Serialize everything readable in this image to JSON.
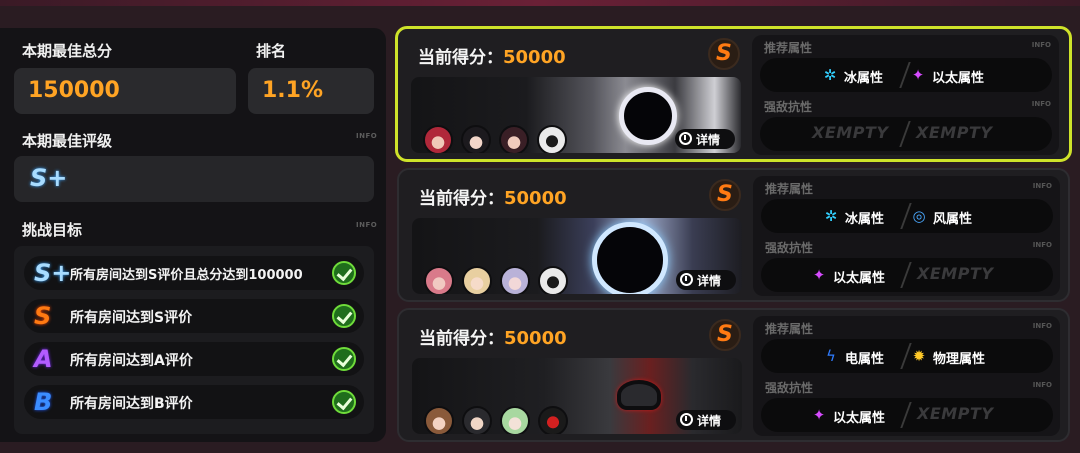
{
  "left": {
    "best_score_label": "本期最佳总分",
    "rank_label": "排名",
    "best_score": "150000",
    "rank": "1.1%",
    "best_grade_label": "本期最佳评级",
    "info": "INFO",
    "best_grade": "S+",
    "goals_label": "挑战目标",
    "goals": [
      {
        "badge": "S+",
        "text": "所有房间达到S评价且总分达到100000"
      },
      {
        "badge": "S",
        "text": "所有房间达到S评价"
      },
      {
        "badge": "A",
        "text": "所有房间达到A评价"
      },
      {
        "badge": "B",
        "text": "所有房间达到B评价"
      }
    ]
  },
  "rooms": [
    {
      "score_label": "当前得分：",
      "score": "50000",
      "grade": "S",
      "detail": "详情",
      "recommend_label": "推荐属性",
      "resist_label": "强敌抗性",
      "info": "INFO",
      "recommend": [
        "冰属性",
        "以太属性"
      ],
      "resist": [
        "EMPTY",
        "EMPTY"
      ]
    },
    {
      "score_label": "当前得分：",
      "score": "50000",
      "grade": "S",
      "detail": "详情",
      "recommend_label": "推荐属性",
      "resist_label": "强敌抗性",
      "info": "INFO",
      "recommend": [
        "冰属性",
        "风属性"
      ],
      "resist": [
        "以太属性",
        "EMPTY"
      ]
    },
    {
      "score_label": "当前得分：",
      "score": "50000",
      "grade": "S",
      "detail": "详情",
      "recommend_label": "推荐属性",
      "resist_label": "强敌抗性",
      "info": "INFO",
      "recommend": [
        "电属性",
        "物理属性"
      ],
      "resist": [
        "以太属性",
        "EMPTY"
      ]
    }
  ],
  "colors": {
    "accent_orange": "#ffa424",
    "active_border": "#cfe22a",
    "check_green": "#6fdc3a"
  },
  "icons": {
    "ice": "ice-icon",
    "ether": "ether-icon",
    "wind": "wind-icon",
    "electric": "electric-icon",
    "physical": "physical-icon",
    "detail": "detail-icon",
    "check": "check-icon"
  }
}
